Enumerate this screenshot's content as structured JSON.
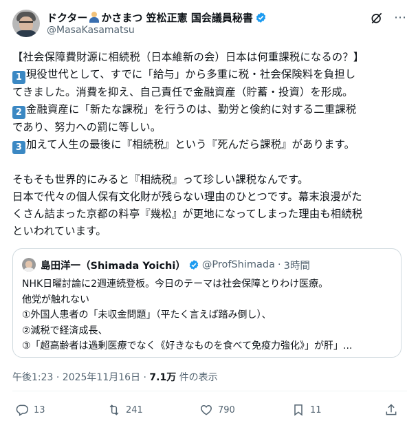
{
  "author": {
    "name_part1": "ドクター",
    "name_part2": "かさまつ 笠松正憲 国会議員秘書",
    "handle": "@MasaKasamatsu",
    "emoji_icon": "technologist-emoji-icon",
    "verified_color": "#1d9bf0"
  },
  "tweet": {
    "line1": "【社会保障費財源に相続税（日本維新の会）日本は何重課税になるの？】",
    "n1": "1",
    "line2a": "現役世代として、すでに「給与」から多重に税・社会保険料を負担し",
    "line2b": "てきました。消費を抑え、自己責任で金融資産（貯蓄・投資）を形成。",
    "n2": "2",
    "line3a": "金融資産に「新たな課税」を行うのは、勤労と倹約に対する二重課税",
    "line3b": "であり、努力への罰に等しい。",
    "n3": "3",
    "line4": "加えて人生の最後に『相続税』という『死んだら課税』があります。",
    "line5": "そもそも世界的にみると『相続税』って珍しい課税なんです。",
    "line6a": "日本で代々の個人保有文化財が残らない理由のひとつです。幕末浪漫がた",
    "line6b": "くさん詰まった京都の料亭『幾松』が更地になってしまった理由も相続税",
    "line6c": "といわれています。"
  },
  "quote": {
    "name": "島田洋一（Shimada Yoichi）",
    "handle": "@ProfShimada",
    "dot": "·",
    "time": "3時間",
    "body1": "NHK日曜討論に2週連続登板。今日のテーマは社会保障とりわけ医療。",
    "body2": "他党が触れない",
    "body3": "①外国人患者の「未収金問題」（平たく言えば踏み倒し）、",
    "body4": "②減税で経済成長、",
    "body5": "③「超高齢者は過剰医療でなく《好きなものを食べて免疫力強化》」が肝」..."
  },
  "meta": {
    "time": "午後1:23 · 2025年11月16日 · ",
    "views": "7.1万",
    "views_label": " 件の表示"
  },
  "actions": {
    "replies": "13",
    "reposts": "241",
    "likes": "790",
    "bookmarks": "11"
  },
  "colors": {
    "accent": "#1d9bf0",
    "number_badge": "#3b88c3",
    "secondary_text": "#536471",
    "border": "#cfd9de"
  }
}
